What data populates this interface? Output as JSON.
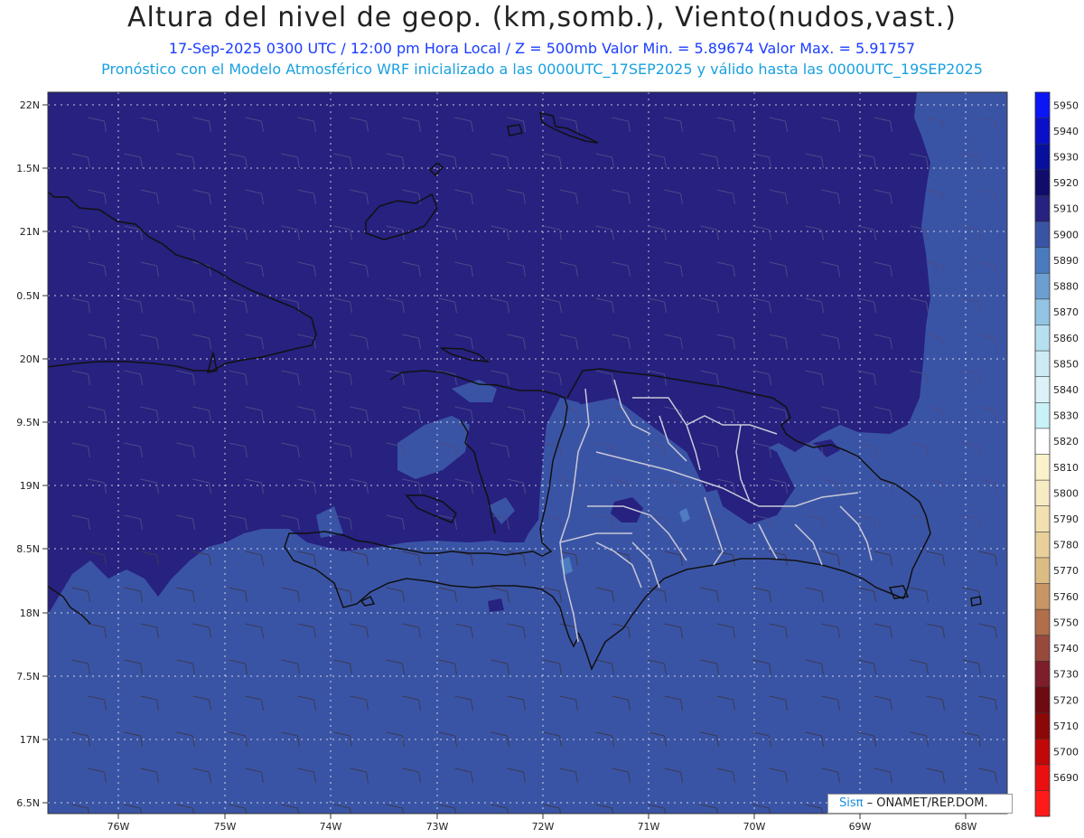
{
  "header": {
    "title": "Altura del nivel de geop. (km,somb.), Viento(nudos,vast.)",
    "subtitle": "17-Sep-2025  0300 UTC / 12:00 pm Hora Local / Z = 500mb    Valor Min. = 5.89674  Valor Max. = 5.91757",
    "subtitle2": "Pronóstico con el Modelo Atmosférico WRF inicializado a las 0000UTC_17SEP2025 y válido hasta las  0000UTC_19SEP2025"
  },
  "map": {
    "lat_labels": [
      "22N",
      "1.5N",
      "21N",
      "0.5N",
      "20N",
      "9.5N",
      "19N",
      "8.5N",
      "18N",
      "7.5N",
      "17N",
      "6.5N"
    ],
    "lon_labels": [
      "76W",
      "75W",
      "74W",
      "73W",
      "72W",
      "71W",
      "70W",
      "69W",
      "68W"
    ],
    "fill_colors": {
      "level_5910": "#27217f",
      "level_5900": "#3a54a5",
      "level_5890": "#4d7cc0"
    },
    "coast_color": "#111111",
    "border_color": "#c8c8d8"
  },
  "colorbar": {
    "levels": [
      5950,
      5940,
      5930,
      5920,
      5910,
      5900,
      5890,
      5880,
      5870,
      5860,
      5850,
      5840,
      5830,
      5820,
      5810,
      5800,
      5790,
      5780,
      5770,
      5760,
      5750,
      5740,
      5730,
      5720,
      5710,
      5700,
      5690
    ],
    "colors": [
      "#0b16f5",
      "#0a10c8",
      "#07109c",
      "#100c6c",
      "#27217f",
      "#3a54a5",
      "#4a7bbe",
      "#6c9fd0",
      "#93c4e4",
      "#b6e0ef",
      "#cdebf5",
      "#dcf2f8",
      "#c8f1f8",
      "#ffffff",
      "#fbf2cc",
      "#f7ebc4",
      "#f2e0b0",
      "#e9d09b",
      "#dcbc85",
      "#c89666",
      "#b06e4b",
      "#974a3c",
      "#7e1e2a",
      "#6e0a12",
      "#8a0808",
      "#c00808",
      "#e81010",
      "#ff1a1a"
    ]
  },
  "credit": {
    "brand": "Sisπ",
    "text": " – ONAMET/REP.DOM."
  }
}
